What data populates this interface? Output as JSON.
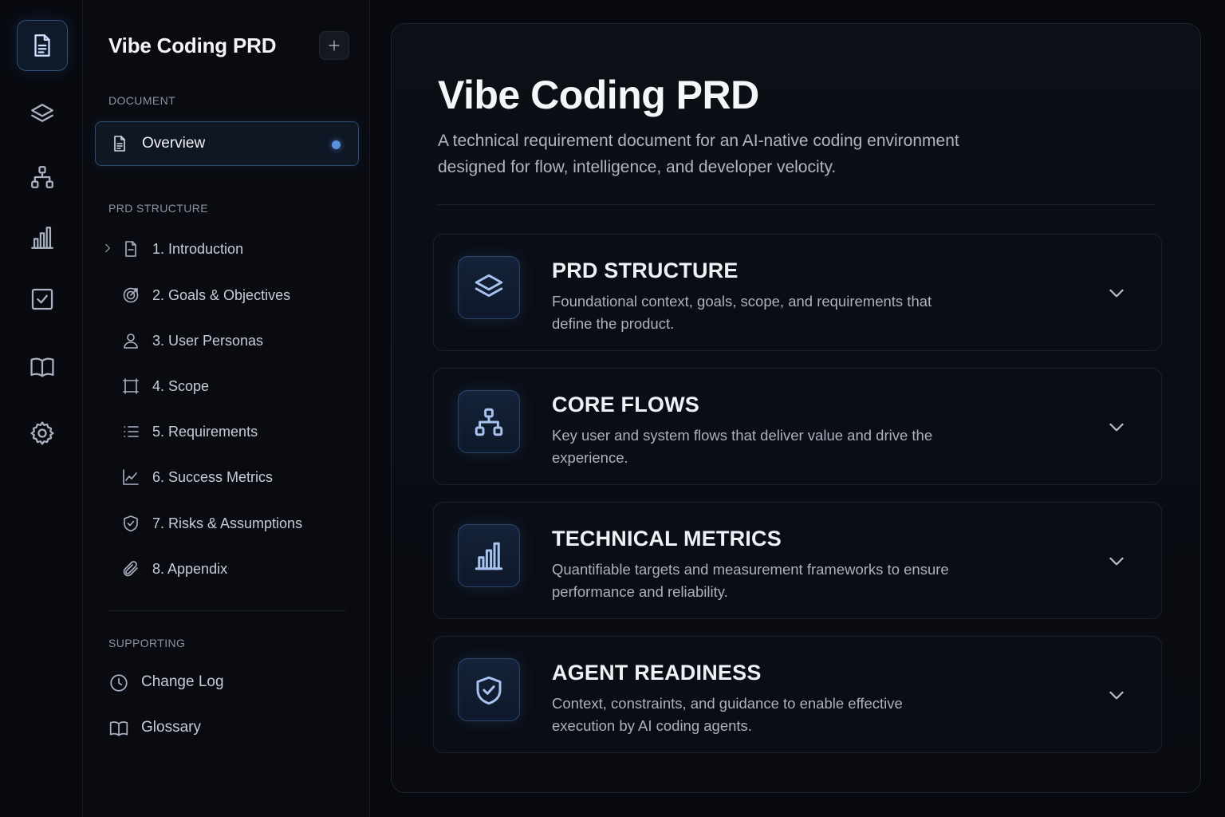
{
  "rail": {
    "items": [
      {
        "icon": "document-icon",
        "active": true
      },
      {
        "icon": "layers-icon",
        "active": false
      },
      {
        "icon": "sitemap-icon",
        "active": false
      },
      {
        "icon": "bar-chart-icon",
        "active": false
      },
      {
        "icon": "checkbox-icon",
        "active": false
      },
      {
        "icon": "book-icon",
        "active": false
      },
      {
        "icon": "gear-icon",
        "active": false
      }
    ]
  },
  "nav": {
    "title": "Vibe Coding PRD",
    "document_label": "DOCUMENT",
    "overview_label": "Overview",
    "prd_structure_label": "PRD STRUCTURE",
    "prd_items": [
      {
        "label": "1. Introduction",
        "icon": "document-icon"
      },
      {
        "label": "2. Goals & Objectives",
        "icon": "target-icon"
      },
      {
        "label": "3. User Personas",
        "icon": "user-icon"
      },
      {
        "label": "4. Scope",
        "icon": "scope-frame-icon"
      },
      {
        "label": "5. Requirements",
        "icon": "list-icon"
      },
      {
        "label": "6. Success Metrics",
        "icon": "trend-chart-icon"
      },
      {
        "label": "7. Risks & Assumptions",
        "icon": "shield-check-icon"
      },
      {
        "label": "8. Appendix",
        "icon": "paperclip-icon"
      }
    ],
    "supporting_label": "SUPPORTING",
    "supporting_items": [
      {
        "label": "Change Log",
        "icon": "clock-icon"
      },
      {
        "label": "Glossary",
        "icon": "book-icon"
      }
    ]
  },
  "main": {
    "title": "Vibe Coding PRD",
    "description": "A technical requirement document for an AI-native coding environment designed for flow, intelligence, and developer velocity.",
    "sections": [
      {
        "title": "PRD STRUCTURE",
        "description": "Foundational context, goals, scope, and requirements that define the product.",
        "icon": "layers-icon"
      },
      {
        "title": "CORE FLOWS",
        "description": "Key user and system flows that deliver value and drive the experience.",
        "icon": "sitemap-icon"
      },
      {
        "title": "TECHNICAL METRICS",
        "description": "Quantifiable targets and measurement frameworks to ensure performance and reliability.",
        "icon": "bar-chart-icon"
      },
      {
        "title": "AGENT READINESS",
        "description": "Context, constraints, and guidance to enable effective execution by AI coding agents.",
        "icon": "shield-check-icon"
      }
    ]
  },
  "colors": {
    "background": "#07090e",
    "accent": "#5a8fe0",
    "accent_border": "#2f4b70",
    "text_primary": "#f2f4f8",
    "text_secondary": "#aeb5c3"
  }
}
